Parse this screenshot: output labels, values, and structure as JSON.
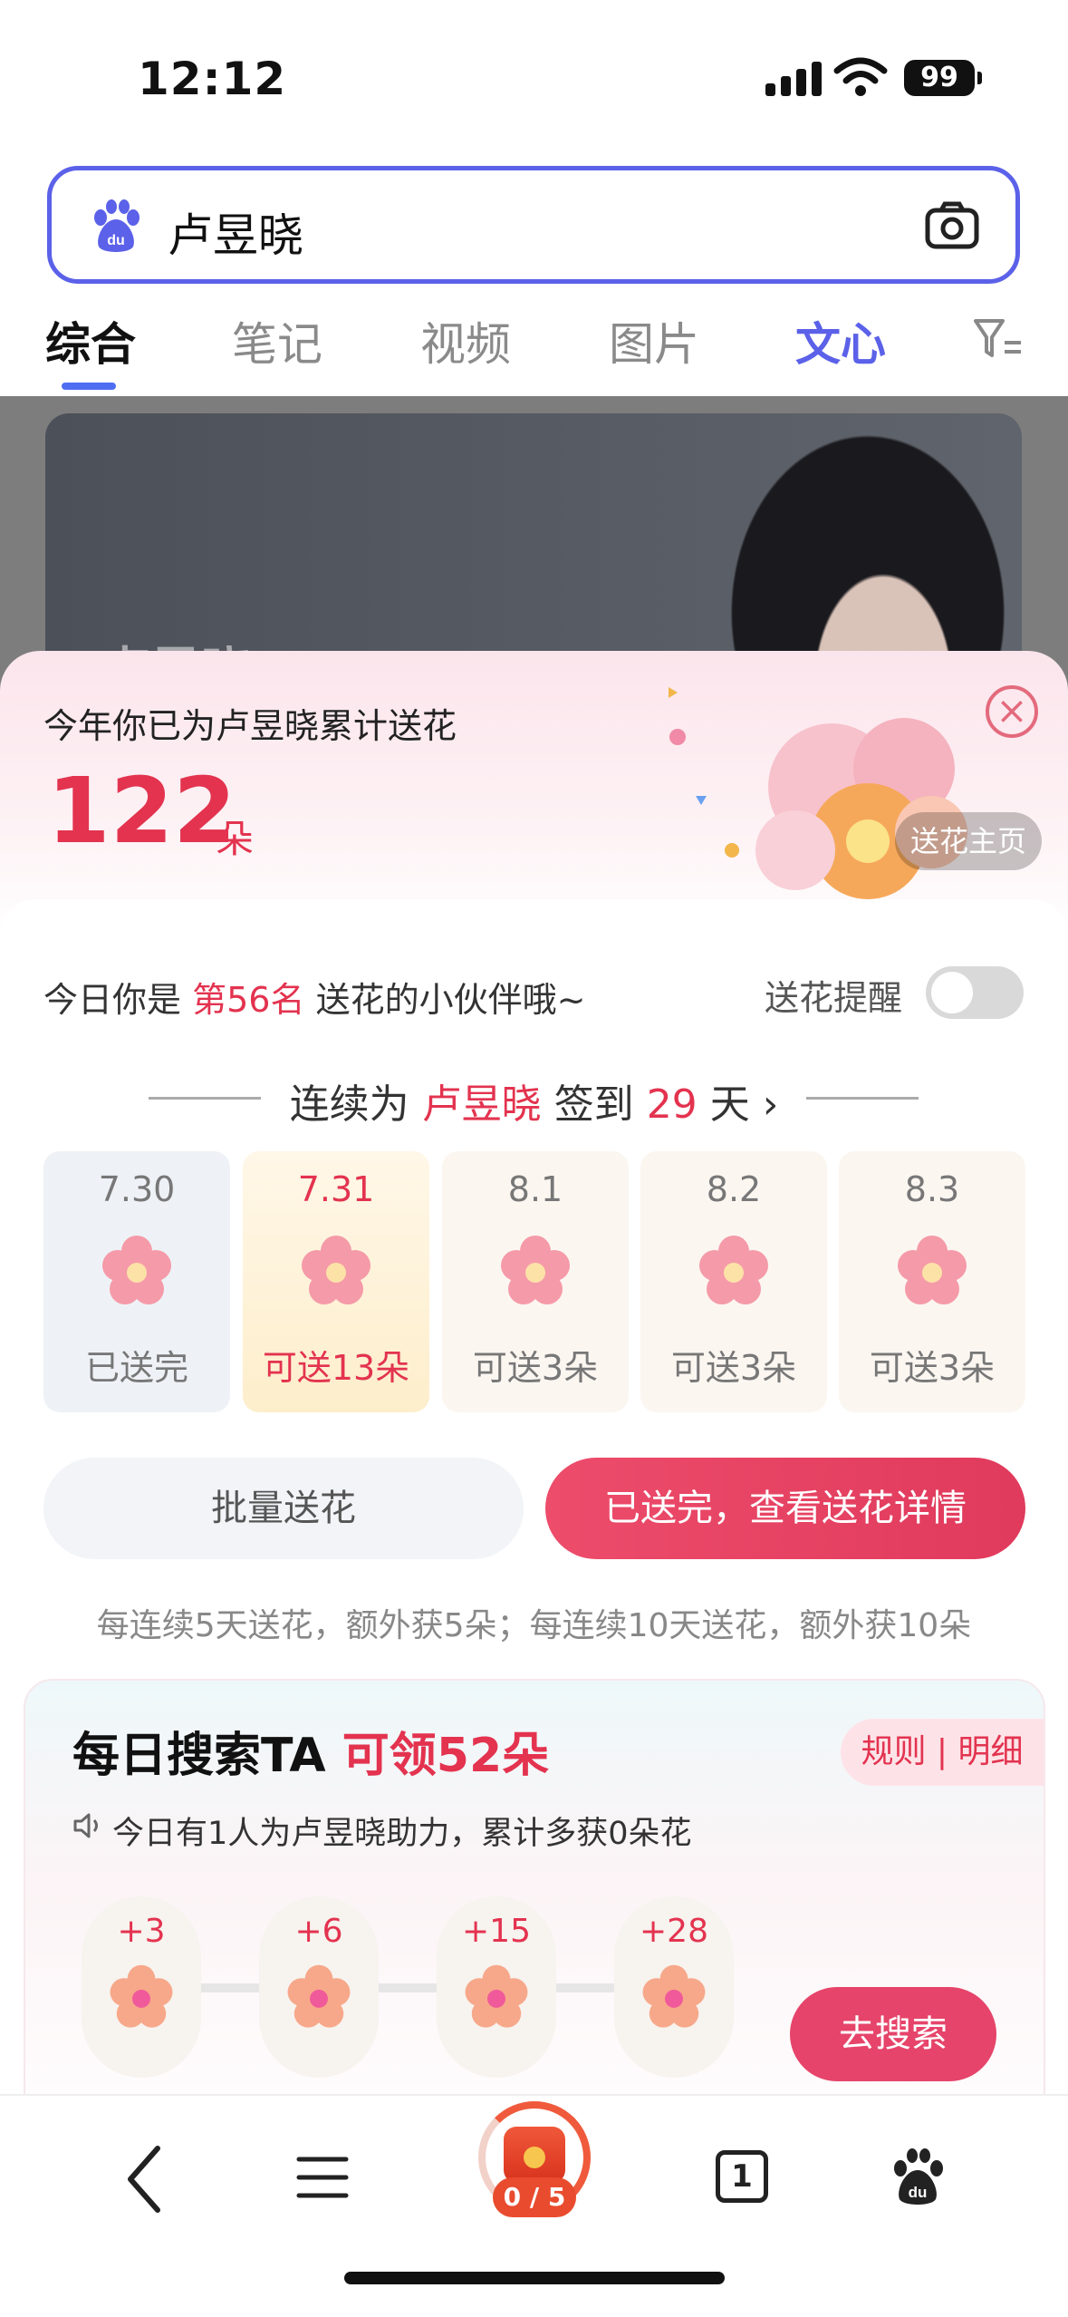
{
  "status_bar": {
    "time": "12:12",
    "battery": "99"
  },
  "search": {
    "query": "卢昱晓"
  },
  "tabs": [
    {
      "label": "综合"
    },
    {
      "label": "笔记"
    },
    {
      "label": "视频"
    },
    {
      "label": "图片"
    },
    {
      "label": "文心"
    }
  ],
  "hero": {
    "name": "卢昱晓"
  },
  "sheet": {
    "header": "今年你已为卢昱晓累计送花",
    "count": "122",
    "unit": "朵",
    "home_button": "送花主页",
    "rank_prefix": "今日你是",
    "rank": "第56名",
    "rank_suffix": "送花的小伙伴哦~",
    "reminder_label": "送花提醒",
    "reminder_on": false,
    "streak": {
      "prefix": "连续为",
      "name": "卢昱晓",
      "middle": "签到",
      "days": "29",
      "suffix": "天"
    },
    "days": [
      {
        "date": "7.30",
        "status": "已送完"
      },
      {
        "date": "7.31",
        "status": "可送13朵"
      },
      {
        "date": "8.1",
        "status": "可送3朵"
      },
      {
        "date": "8.2",
        "status": "可送3朵"
      },
      {
        "date": "8.3",
        "status": "可送3朵"
      }
    ],
    "batch_button": "批量送花",
    "done_button": "已送完，查看送花详情",
    "tip": "每连续5天送花，额外获5朵；每连续10天送花，额外获10朵",
    "daily": {
      "title": "每日搜索TA",
      "reward": "可领52朵",
      "rules": "规则 | 明细",
      "assist": "今日有1人为卢昱晓助力，累计多获0朵花",
      "steps": [
        "+3",
        "+6",
        "+15",
        "+28"
      ],
      "go_button": "去搜索"
    }
  },
  "nav": {
    "red_packet": "0 / 5",
    "tab_count": "1"
  },
  "colors": {
    "accent": "#e3334f",
    "brand": "#5b61e8"
  }
}
